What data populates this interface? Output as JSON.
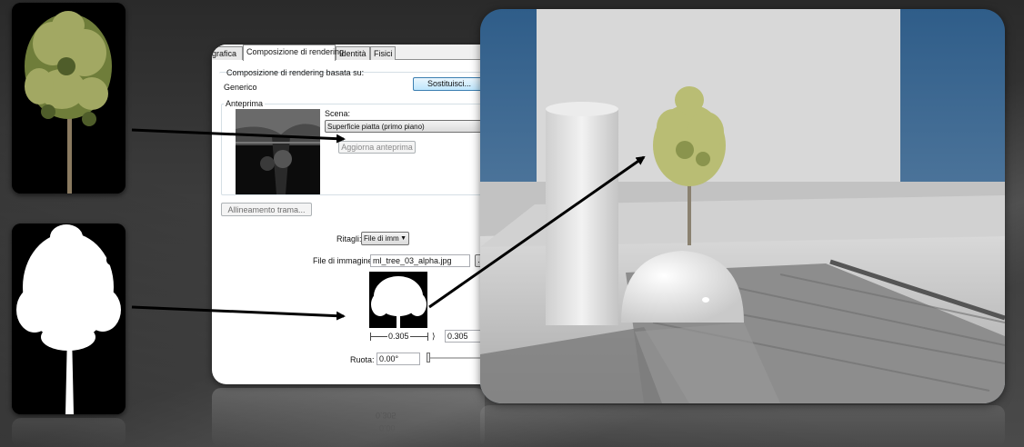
{
  "dialog": {
    "tabs": [
      {
        "label": "grafica"
      },
      {
        "label": "Composizione di rendering"
      },
      {
        "label": "Identità"
      },
      {
        "label": "Fisici"
      }
    ],
    "based_on_label": "Composizione di rendering basata su:",
    "based_on_value": "Generico",
    "replace_button": "Sostituisci...",
    "preview_group_label": "Anteprima",
    "scene_label": "Scena:",
    "scene_value": "Superficie piatta (primo piano)",
    "update_preview_button": "Aggiorna anteprima",
    "texture_alignment_button": "Allineamento trama...",
    "cutouts_label": "Ritagli:",
    "cutouts_value": "File di imm",
    "image_file_label": "File di immagine:",
    "image_file_value": "ml_tree_03_alpha.jpg",
    "browse_button": "...",
    "width_value": "0.305",
    "height_value": "0.305",
    "rotate_label": "Ruota:",
    "rotate_value": "0.00°",
    "reflection_text_1": "0.305",
    "reflection_text_2": "0.00"
  },
  "colors": {
    "accent_button": "#bee6fd",
    "background": "#3c3c3c",
    "sky": "#3e6f9e"
  },
  "icons": {
    "dropdown": "chevron-down-icon",
    "arrows": "arrow-icon"
  }
}
